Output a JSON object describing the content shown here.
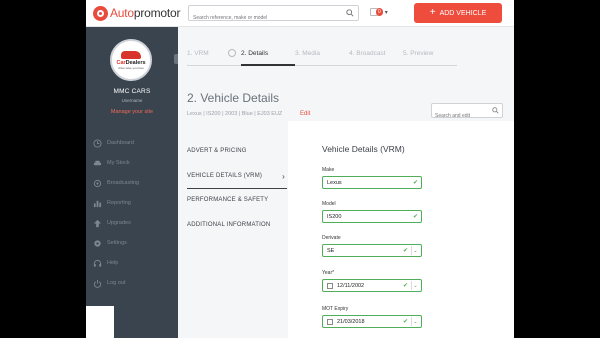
{
  "topbar": {
    "logo_text_a": "Auto",
    "logo_text_b": "promotor",
    "search_placeholder": "Search reference, make or model",
    "notif_count": "0",
    "add_vehicle_label": "ADD VEHICLE",
    "accent": "#ee4d3d"
  },
  "sidebar": {
    "avatar_brand_a": "Car",
    "avatar_brand_b": "Dealers",
    "avatar_tagline": "drive save you love",
    "dealer_name": "MMC CARS",
    "username": "Username",
    "manage_link": "Manage your site",
    "items": [
      {
        "label": "Dashboard",
        "icon": "clock-icon"
      },
      {
        "label": "My Stock",
        "icon": "car-icon"
      },
      {
        "label": "Broadcasting",
        "icon": "broadcast-icon"
      },
      {
        "label": "Reporting",
        "icon": "bar-chart-icon"
      },
      {
        "label": "Upgrades",
        "icon": "upgrade-arrow-icon"
      },
      {
        "label": "Settings",
        "icon": "gear-icon"
      },
      {
        "label": "Help",
        "icon": "headset-icon"
      },
      {
        "label": "Log out",
        "icon": "power-icon"
      }
    ]
  },
  "steps": [
    {
      "label": "1. VRM"
    },
    {
      "label": "2. Details"
    },
    {
      "label": "3. Media"
    },
    {
      "label": "4. Broadcast"
    },
    {
      "label": "5. Preview"
    }
  ],
  "page": {
    "title": "2. Vehicle Details",
    "subline": "Lexus | IS200 | 2003 | Blue | EJ03 EUZ",
    "edit_label": "Edit",
    "search_placeholder": "Search and edit"
  },
  "sections": [
    {
      "label": "ADVERT & PRICING"
    },
    {
      "label": "VEHICLE DETAILS (VRM)"
    },
    {
      "label": "PERFORMANCE & SAFETY"
    },
    {
      "label": "ADDITIONAL INFORMATION"
    }
  ],
  "form": {
    "title": "Vehicle Details (VRM)",
    "make": {
      "label": "Make",
      "value": "Lexus"
    },
    "model": {
      "label": "Model",
      "value": "IS200"
    },
    "derivate": {
      "label": "Derivate",
      "value": "SE"
    },
    "year": {
      "label": "Year*",
      "value": "12/11/2002"
    },
    "mot": {
      "label": "MOT Expiry",
      "value": "21/03/2018"
    }
  }
}
